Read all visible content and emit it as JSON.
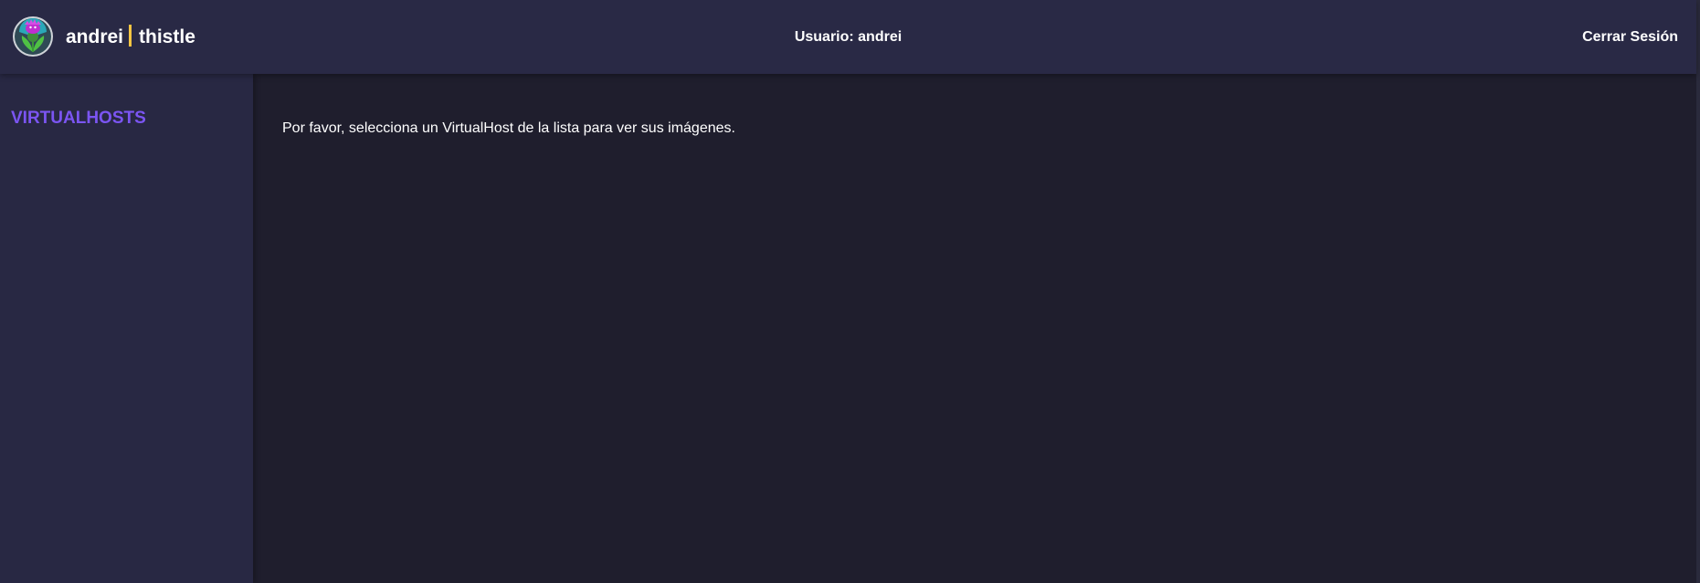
{
  "header": {
    "brand_user": "andrei",
    "brand_app": "thistle",
    "user_label": "Usuario: andrei",
    "logout_label": "Cerrar Sesión",
    "logo_icon": "thistle-logo-icon"
  },
  "sidebar": {
    "title": "VIRTUALHOSTS"
  },
  "main": {
    "message": "Por favor, selecciona un VirtualHost de la lista para ver sus imágenes."
  },
  "colors": {
    "header_bg": "#292945",
    "sidebar_bg": "#282843",
    "main_bg": "#1f1e2d",
    "accent": "#7b55f2",
    "separator": "#f5c542"
  }
}
